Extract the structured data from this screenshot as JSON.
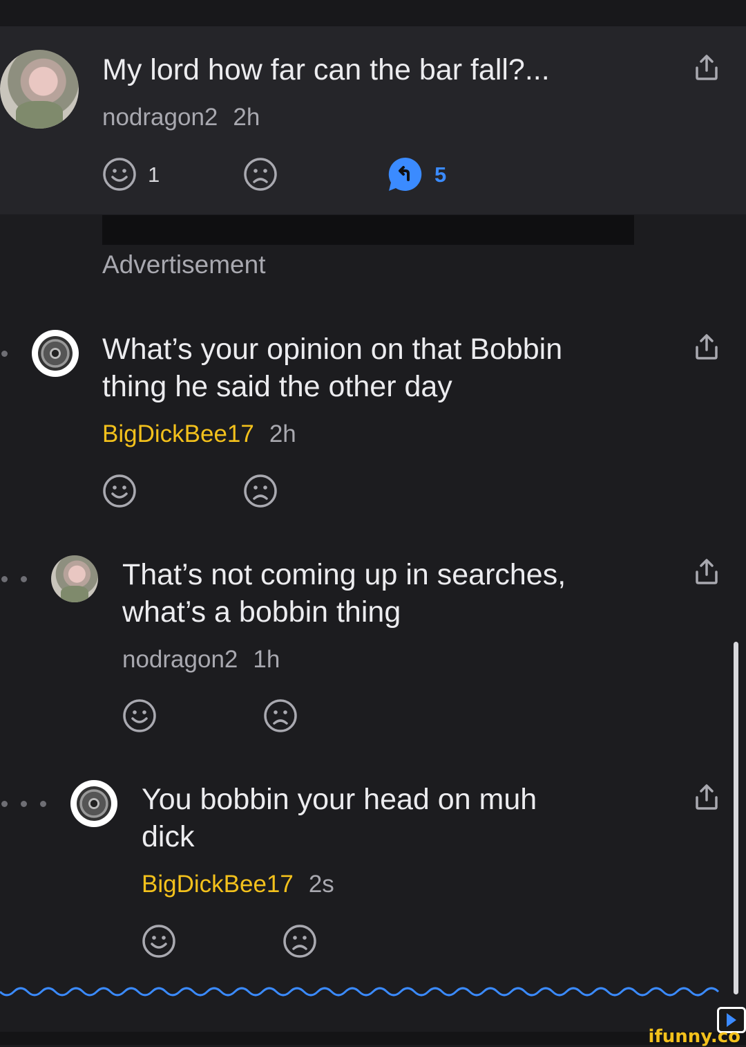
{
  "post": {
    "title": "My lord how far can the bar fall?...",
    "author": "nodragon2",
    "time": "2h",
    "likes": "1",
    "replies": "5"
  },
  "ad": {
    "label": "Advertisement"
  },
  "comments": [
    {
      "line1": "What’s your opinion on that Bobbin",
      "line2": "thing he said the other day",
      "author": "BigDickBee17",
      "time": "2h"
    },
    {
      "line1": "That’s not coming up in searches,",
      "line2": "what’s a bobbin thing",
      "author": "nodragon2",
      "time": "1h"
    },
    {
      "line1": "You bobbin your head on muh",
      "line2": "dick",
      "author": "BigDickBee17",
      "time": "2s"
    }
  ],
  "watermark": {
    "text": "ifunny.co"
  },
  "colors": {
    "background": "#1c1c1f",
    "post_background": "#252529",
    "username_highlight": "#f3c11c",
    "accent_blue": "#3b8bff"
  },
  "icons": {
    "like": "smile-icon",
    "dislike": "frown-icon",
    "reply": "reply-bubble-icon",
    "share": "share-icon"
  }
}
